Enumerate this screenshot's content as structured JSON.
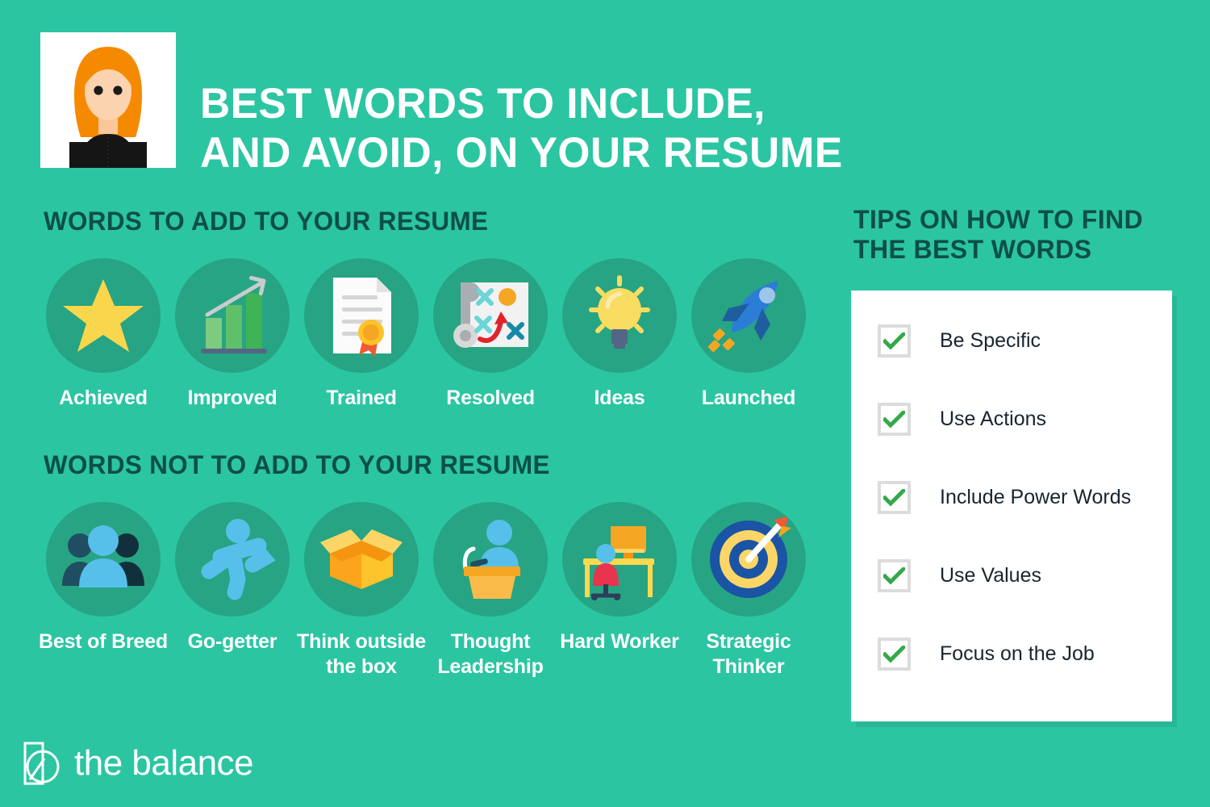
{
  "theme": {
    "background": "#2BC5A2",
    "circle": "#27A483",
    "heading_dark": "#0C4F46",
    "white": "#FFFFFF",
    "check_green": "#34A84A",
    "checkbox_border": "#DCDCDC",
    "tip_text": "#17252E"
  },
  "header": {
    "avatar_alt": "woman-avatar",
    "title_lines": [
      "BEST WORDS TO INCLUDE,",
      "AND AVOID, ON YOUR RESUME"
    ]
  },
  "sections": {
    "add": {
      "heading": "WORDS TO ADD TO YOUR RESUME",
      "items": [
        {
          "label": "Achieved",
          "icon": "star-icon"
        },
        {
          "label": "Improved",
          "icon": "bar-chart-growth-icon"
        },
        {
          "label": "Trained",
          "icon": "certificate-icon"
        },
        {
          "label": "Resolved",
          "icon": "strategy-playbook-icon"
        },
        {
          "label": "Ideas",
          "icon": "lightbulb-icon"
        },
        {
          "label": "Launched",
          "icon": "rocket-icon"
        }
      ]
    },
    "avoid": {
      "heading": "WORDS NOT TO ADD TO YOUR RESUME",
      "items": [
        {
          "label": "Best of Breed",
          "icon": "people-group-icon"
        },
        {
          "label": "Go-getter",
          "icon": "running-person-icon"
        },
        {
          "label": "Think outside the box",
          "icon": "open-box-icon"
        },
        {
          "label": "Thought Leadership",
          "icon": "podium-speaker-icon"
        },
        {
          "label": "Hard Worker",
          "icon": "desk-worker-icon"
        },
        {
          "label": "Strategic Thinker",
          "icon": "target-dart-icon"
        }
      ]
    },
    "tips": {
      "heading": "TIPS ON HOW TO FIND THE BEST WORDS",
      "items": [
        {
          "label": "Be Specific",
          "checked": true
        },
        {
          "label": "Use Actions",
          "checked": true
        },
        {
          "label": "Include Power Words",
          "checked": true
        },
        {
          "label": "Use Values",
          "checked": true
        },
        {
          "label": "Focus on the Job",
          "checked": true
        }
      ]
    }
  },
  "footer": {
    "brand": "the balance",
    "logo_icon": "the-balance-logo-icon"
  }
}
